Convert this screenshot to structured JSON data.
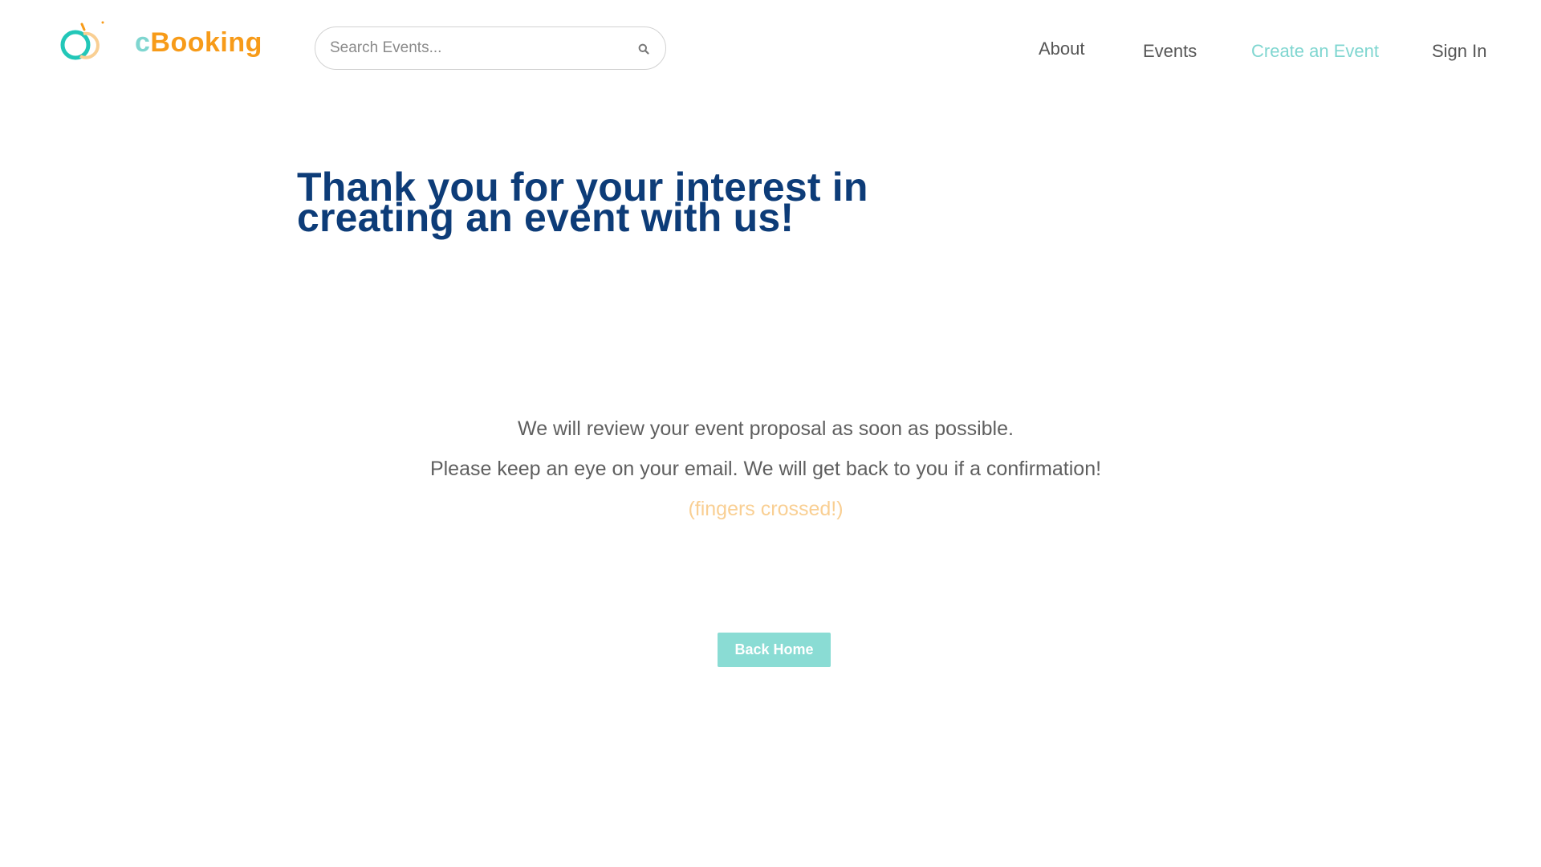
{
  "brand": {
    "logo_icon": "cbooking-logo-icon",
    "name_prefix": "c",
    "name_suffix": "Booking",
    "colors": {
      "teal": "#7fd6d0",
      "orange": "#f79b19"
    }
  },
  "search": {
    "placeholder": "Search Events...",
    "value": "",
    "icon": "search-icon"
  },
  "nav": {
    "items": [
      {
        "label": "About",
        "active": false
      },
      {
        "label": "Events",
        "active": false
      },
      {
        "label": "Create an Event",
        "active": true
      },
      {
        "label": "Sign In",
        "active": false
      }
    ],
    "active_color": "#7fd6d0"
  },
  "main": {
    "headline": "Thank you for your interest in creating an event with us!",
    "messages": [
      "We will review your event proposal as soon as possible.",
      "Please keep an eye on your email. We will get back to you if a confirmation!",
      "(fingers crossed!)"
    ],
    "back_button_label": "Back Home",
    "colors": {
      "headline": "#0d3c78",
      "body_text": "#5f5f5f",
      "accent_text": "#f9cf93",
      "button_bg": "#8adcd4"
    }
  }
}
